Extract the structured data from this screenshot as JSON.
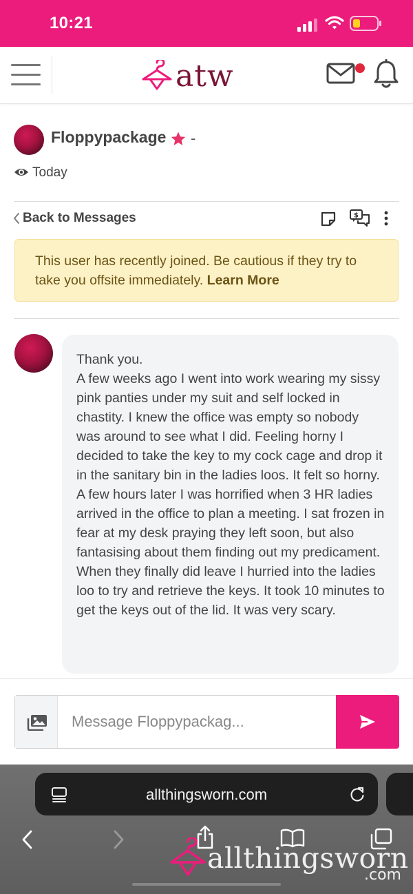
{
  "status_bar": {
    "time": "10:21"
  },
  "header": {
    "logo_text": "atw"
  },
  "profile": {
    "name": "Floppypackage",
    "suffix": "-",
    "last_seen": "Today"
  },
  "actions": {
    "back_label": "Back to Messages"
  },
  "warning": {
    "text": "This user has recently joined. Be cautious if they try to take you offsite immediately. ",
    "link_label": "Learn More"
  },
  "message": {
    "text": "Thank you.\nA few weeks ago I went into work wearing my sissy pink panties under my suit and self locked in chastity. I knew the office was empty so nobody was around to see what I did. Feeling horny I decided to take the key to my cock cage and drop it in the sanitary bin in the ladies loos. It felt so horny. A few hours later I was horrified when 3 HR ladies arrived in the office to plan a meeting. I sat frozen in fear at my desk praying they left soon, but also fantasising about them finding out my predicament. When they finally did leave I hurried into the ladies loo to try and retrieve the keys. It took 10 minutes to get the keys out of the lid. It was very scary."
  },
  "composer": {
    "placeholder": "Message Floppypackag..."
  },
  "browser": {
    "url": "allthingsworn.com"
  },
  "watermark": {
    "text": "allthingsworn",
    "suffix": ".com"
  },
  "colors": {
    "brand_pink": "#ec1c7c",
    "logo_maroon": "#7a1535",
    "warning_bg": "#fdf1c6",
    "bubble_bg": "#f3f4f6"
  },
  "icons": [
    "signal-icon",
    "wifi-icon",
    "battery-icon",
    "menu-icon",
    "hanger-logo",
    "mail-icon",
    "bell-icon",
    "star-icon",
    "eye-icon",
    "chevron-left-icon",
    "note-icon",
    "offer-icon",
    "more-icon",
    "image-icon",
    "send-icon",
    "tabs-list-icon",
    "reload-icon",
    "share-icon",
    "bookmarks-icon",
    "tabs-icon"
  ]
}
